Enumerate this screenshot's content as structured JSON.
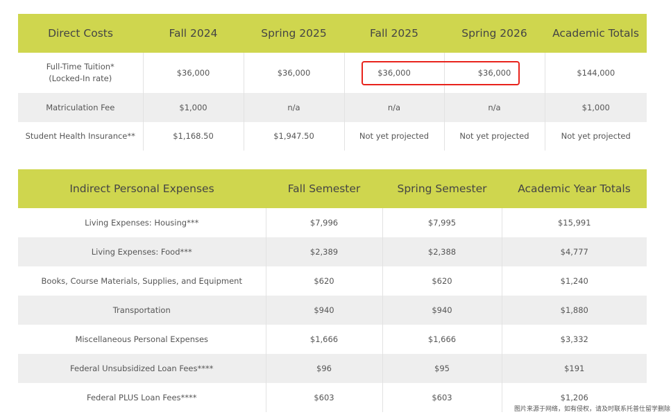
{
  "direct_costs": {
    "headers": [
      "Direct Costs",
      "Fall 2024",
      "Spring 2025",
      "Fall 2025",
      "Spring 2026",
      "Academic Totals"
    ],
    "rows": [
      {
        "label_line1": "Full-Time Tuition*",
        "label_line2": "(Locked-In rate)",
        "values": [
          "$36,000",
          "$36,000",
          "$36,000",
          "$36,000",
          "$144,000"
        ]
      },
      {
        "label": "Matriculation Fee",
        "values": [
          "$1,000",
          "n/a",
          "n/a",
          "n/a",
          "$1,000"
        ]
      },
      {
        "label": "Student Health Insurance**",
        "values": [
          "$1,168.50",
          "$1,947.50",
          "Not yet projected",
          "Not yet projected",
          "Not yet projected"
        ]
      }
    ]
  },
  "indirect_expenses": {
    "headers": [
      "Indirect Personal Expenses",
      "Fall Semester",
      "Spring Semester",
      "Academic Year Totals"
    ],
    "rows": [
      {
        "label": "Living Expenses: Housing***",
        "values": [
          "$7,996",
          "$7,995",
          "$15,991"
        ]
      },
      {
        "label": "Living Expenses: Food***",
        "values": [
          "$2,389",
          "$2,388",
          "$4,777"
        ]
      },
      {
        "label": "Books, Course Materials, Supplies, and Equipment",
        "values": [
          "$620",
          "$620",
          "$1,240"
        ]
      },
      {
        "label": "Transportation",
        "values": [
          "$940",
          "$940",
          "$1,880"
        ]
      },
      {
        "label": "Miscellaneous Personal Expenses",
        "values": [
          "$1,666",
          "$1,666",
          "$3,332"
        ]
      },
      {
        "label": "Federal Unsubsidized Loan Fees****",
        "values": [
          "$96",
          "$95",
          "$191"
        ]
      },
      {
        "label": "Federal PLUS Loan Fees****",
        "values": [
          "$603",
          "$603",
          "$1,206"
        ]
      }
    ]
  },
  "watermark": "图片来源于网络，如有侵权，请及时联系托普仕留学删除",
  "colors": {
    "header_bg": "#cfd64e",
    "highlight_border": "#e8221b",
    "alt_row_bg": "#eeeeee"
  }
}
